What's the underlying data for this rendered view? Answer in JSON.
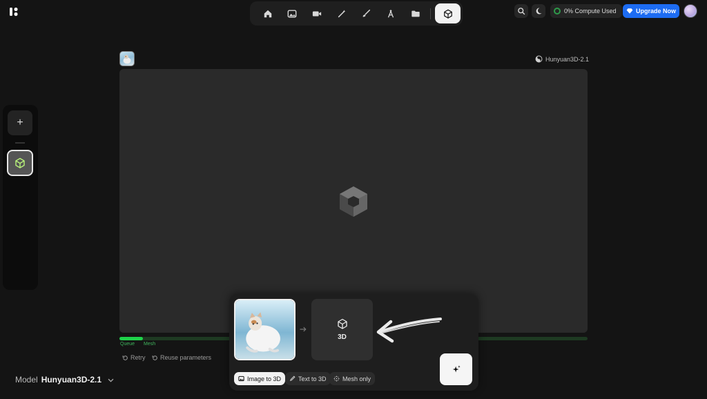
{
  "app": {
    "logo_icon": "krea-logo-icon"
  },
  "toolbar": {
    "tools": [
      {
        "name": "home",
        "icon": "home-icon"
      },
      {
        "name": "image",
        "icon": "image-icon"
      },
      {
        "name": "video",
        "icon": "video-icon"
      },
      {
        "name": "enhance",
        "icon": "magic-wand-icon"
      },
      {
        "name": "edit",
        "icon": "brush-icon"
      },
      {
        "name": "train",
        "icon": "compass-icon"
      },
      {
        "name": "assets",
        "icon": "folder-icon"
      },
      {
        "name": "3d",
        "icon": "cube-icon",
        "active": true
      }
    ]
  },
  "header": {
    "compute_label": "0% Compute Used",
    "upgrade_label": "Upgrade Now",
    "accent_color": "#1d6cf2"
  },
  "sidebar": {
    "new_label": "+"
  },
  "viewer": {
    "model_tag": "Hunyuan3D-2.1"
  },
  "progress": {
    "stages": [
      "Queue",
      "Mesh"
    ],
    "fraction": 0.05,
    "color": "#1fd34a"
  },
  "actions": {
    "retry_label": "Retry",
    "reuse_label": "Reuse parameters"
  },
  "model_selector": {
    "label": "Model",
    "value": "Hunyuan3D-2.1"
  },
  "generation": {
    "output_label": "3D",
    "modes": [
      {
        "label": "Image to 3D",
        "active": true
      },
      {
        "label": "Text to 3D",
        "active": false
      },
      {
        "label": "Mesh only",
        "active": false
      }
    ]
  }
}
